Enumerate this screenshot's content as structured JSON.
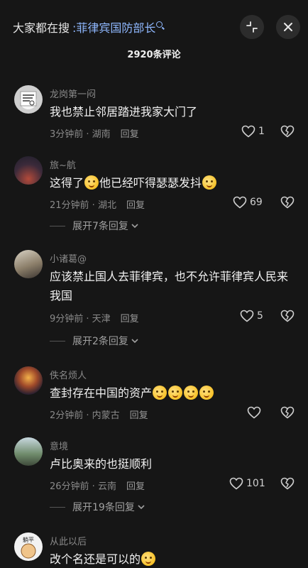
{
  "header": {
    "search_label": "大家都在搜",
    "search_keyword": "菲律宾国防部长",
    "collapse_icon": "collapse-icon",
    "close_icon": "close-icon"
  },
  "comment_count": "2920条评论",
  "comments": [
    {
      "username": "龙岗第一闷",
      "text": "我也禁止邻居踏进我家大门了",
      "time": "3分钟前 · 湖南",
      "reply": "回复",
      "likes": "1"
    },
    {
      "username": "旅~航",
      "text_a": "这得了",
      "text_b": "他已经吓得瑟瑟发抖",
      "time": "21分钟前 · 湖北",
      "reply": "回复",
      "likes": "69",
      "expand": "展开7条回复"
    },
    {
      "username": "小诸葛@",
      "text": "应该禁止国人去菲律宾，也不允许菲律宾人民来我国",
      "time": "9分钟前 · 天津",
      "reply": "回复",
      "likes": "5",
      "expand": "展开2条回复"
    },
    {
      "username": "佚名烦人",
      "text": "查封存在中国的资产",
      "time": "2分钟前 · 内蒙古",
      "reply": "回复",
      "likes": ""
    },
    {
      "username": "意境",
      "text": "卢比奥来的也挺顺利",
      "time": "26分钟前 · 云南",
      "reply": "回复",
      "likes": "101",
      "expand": "展开19条回复"
    },
    {
      "username": "从此以后",
      "text": "改个名还是可以的",
      "avatar_text": "躺平"
    }
  ]
}
